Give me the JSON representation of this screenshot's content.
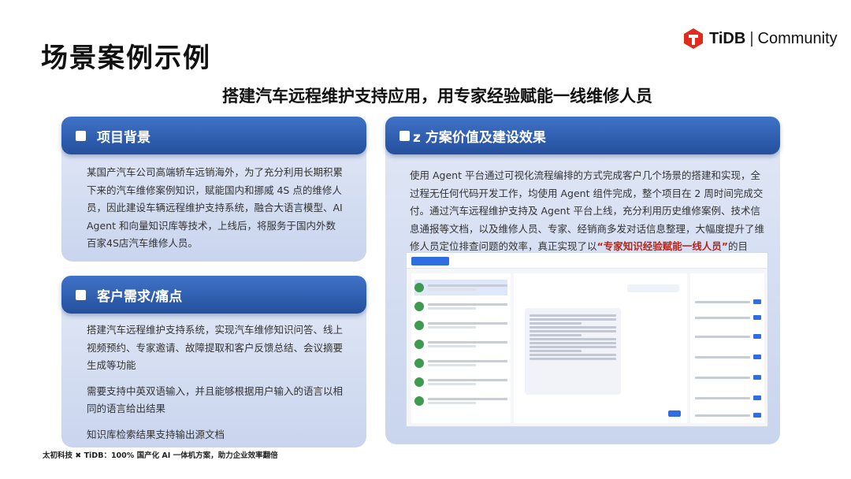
{
  "slide": {
    "title": "场景案例示例",
    "subtitle": "搭建汽车远程维护支持应用，用专家经验赋能一线维修人员",
    "footer": "太初科技 ✖ TiDB：100% 国产化 AI 一体机方案，助力企业效率翻倍"
  },
  "logo": {
    "brand": "TiDB",
    "separator": "|",
    "community": "Community",
    "color": "#e02b20"
  },
  "panels": {
    "background": {
      "title": "项目背景",
      "text": "某国产汽车公司高端轿车远销海外，为了充分利用长期积累下来的汽车维修案例知识，赋能国内和挪威 4S 点的维修人员，因此建设车辆远程维护支持系统，融合大语言模型、AI Agent 和向量知识库等技术，上线后，将服务于国内外数百家4S店汽车维修人员。"
    },
    "needs": {
      "title": "客户需求/痛点",
      "paragraphs": [
        "搭建汽车远程维护支持系统，实现汽车维修知识问答、线上视频预约、专家邀请、故障提取和客户反馈总结、会议摘要生成等功能",
        "需要支持中英双语输入，并且能够根据用户输入的语言以相同的语言给出结果",
        "知识库检索结果支持输出源文档"
      ]
    },
    "value": {
      "title": "z 方案价值及建设效果",
      "text_before": "使用 Agent 平台通过可视化流程编排的方式完成客户几个场景的搭建和实现，全过程无任何代码开发工作，均使用 Agent 组件完成，整个项目在 2 周时间完成交付。通过汽车远程维护支持及 Agent 平台上线，充分利用历史维修案例、技术信息通报等文档，以及维修人员、专家、经销商多发对话信息整理，大幅度提升了维修人员定位排查问题的效率，真正实现了以",
      "highlight": "“专家知识经验赋能一线人员”",
      "text_after": "的目标。"
    }
  },
  "colors": {
    "panel_head": "#2f5fb0",
    "panel_bg": "#d6dff0",
    "highlight": "#b3261e"
  }
}
